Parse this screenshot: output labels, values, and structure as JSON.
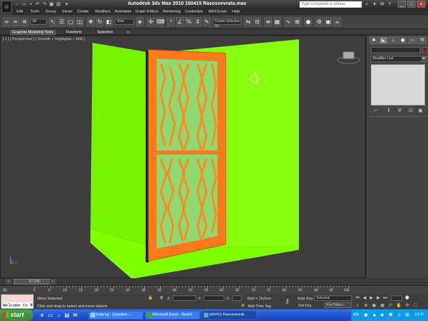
{
  "window": {
    "title": "Autodesk 3ds Max  2010     160415 Razosvevrata.max",
    "search_placeholder": "Type a keyword or phrase"
  },
  "menu": [
    "Edit",
    "Tools",
    "Group",
    "Views",
    "Create",
    "Modifiers",
    "Animation",
    "Graph Editors",
    "Rendering",
    "Customize",
    "MAXScript",
    "Help"
  ],
  "toolbar": {
    "selection_filter": "All",
    "reference_coord": "View",
    "named_selection": "Create Selection Se"
  },
  "ribbon": {
    "tabs": [
      "Graphite Modeling Tools",
      "Freeform",
      "Selection"
    ]
  },
  "viewport": {
    "label": "[ + ] [ Perspective ] [ Smooth + Highlights + MW ]",
    "colors": {
      "background": "#3d3d3d",
      "walls": "#80ff00",
      "frame": "#ff7a1a",
      "glass": "#8fd870",
      "lattice": "#ff8a22"
    }
  },
  "command_panel": {
    "modifier_list": "Modifier List"
  },
  "time_slider": {
    "frame": "0 / 100",
    "ticks": [
      "0",
      "5",
      "10",
      "15",
      "20",
      "25",
      "30",
      "35",
      "40",
      "45",
      "50",
      "55",
      "60",
      "65",
      "70",
      "75",
      "80",
      "85",
      "90",
      "95",
      "100"
    ]
  },
  "status": {
    "maxscript": "Welcome to M",
    "selection": "None Selected",
    "prompt": "Click and drag to select and move objects",
    "x_label": "X:",
    "y_label": "Y:",
    "z_label": "Z:",
    "grid": "Grid = 10,0cm",
    "add_time_tag": "Add Time Tag",
    "auto_key": "Auto Key",
    "set_key": "Set Key",
    "key_mode": "Selected",
    "key_filters": "Key Filters..."
  },
  "taskbar": {
    "start": "start",
    "tasks": [
      {
        "label": "Aula.bg - Question -...",
        "active": false
      },
      {
        "label": "Microsoft Excel - Book1",
        "active": false
      },
      {
        "label": "160415 Razosvevrat...",
        "active": true
      }
    ],
    "lang": "EN",
    "clock": "13:27"
  }
}
